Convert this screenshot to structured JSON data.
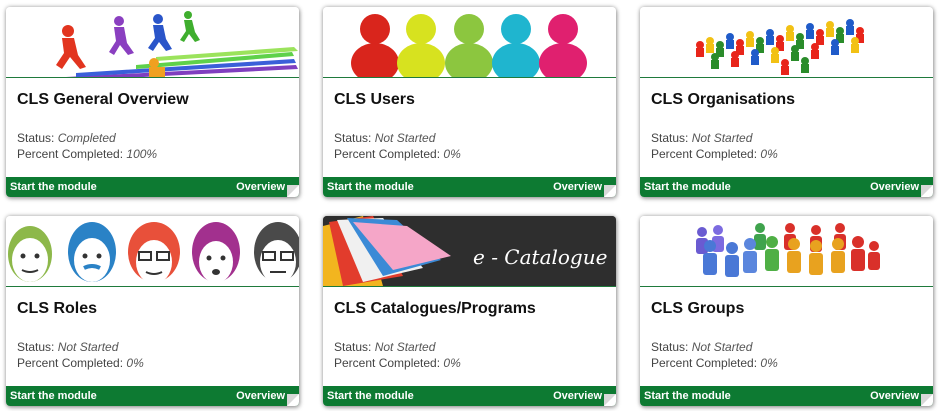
{
  "status_label": "Status:",
  "percent_label": "Percent Completed:",
  "start_label": "Start the module",
  "overview_label": "Overview",
  "modules": [
    {
      "title": "CLS General Overview",
      "status": "Completed",
      "percent": "100%",
      "image": "runners-arrows-icon"
    },
    {
      "title": "CLS Users",
      "status": "Not Started",
      "percent": "0%",
      "image": "colored-user-pawns-icon"
    },
    {
      "title": "CLS Organisations",
      "status": "Not Started",
      "percent": "0%",
      "image": "crowd-of-pawns-icon"
    },
    {
      "title": "CLS Roles",
      "status": "Not Started",
      "percent": "0%",
      "image": "cartoon-faces-icon"
    },
    {
      "title": "CLS Catalogues/Programs",
      "status": "Not Started",
      "percent": "0%",
      "image": "e-catalogue-books-icon",
      "image_text": "e - Catalogue"
    },
    {
      "title": "CLS Groups",
      "status": "Not Started",
      "percent": "0%",
      "image": "group-of-people-icon"
    }
  ],
  "colors": {
    "footer": "#0d7a32",
    "accent_line": "#1f7a3c"
  }
}
